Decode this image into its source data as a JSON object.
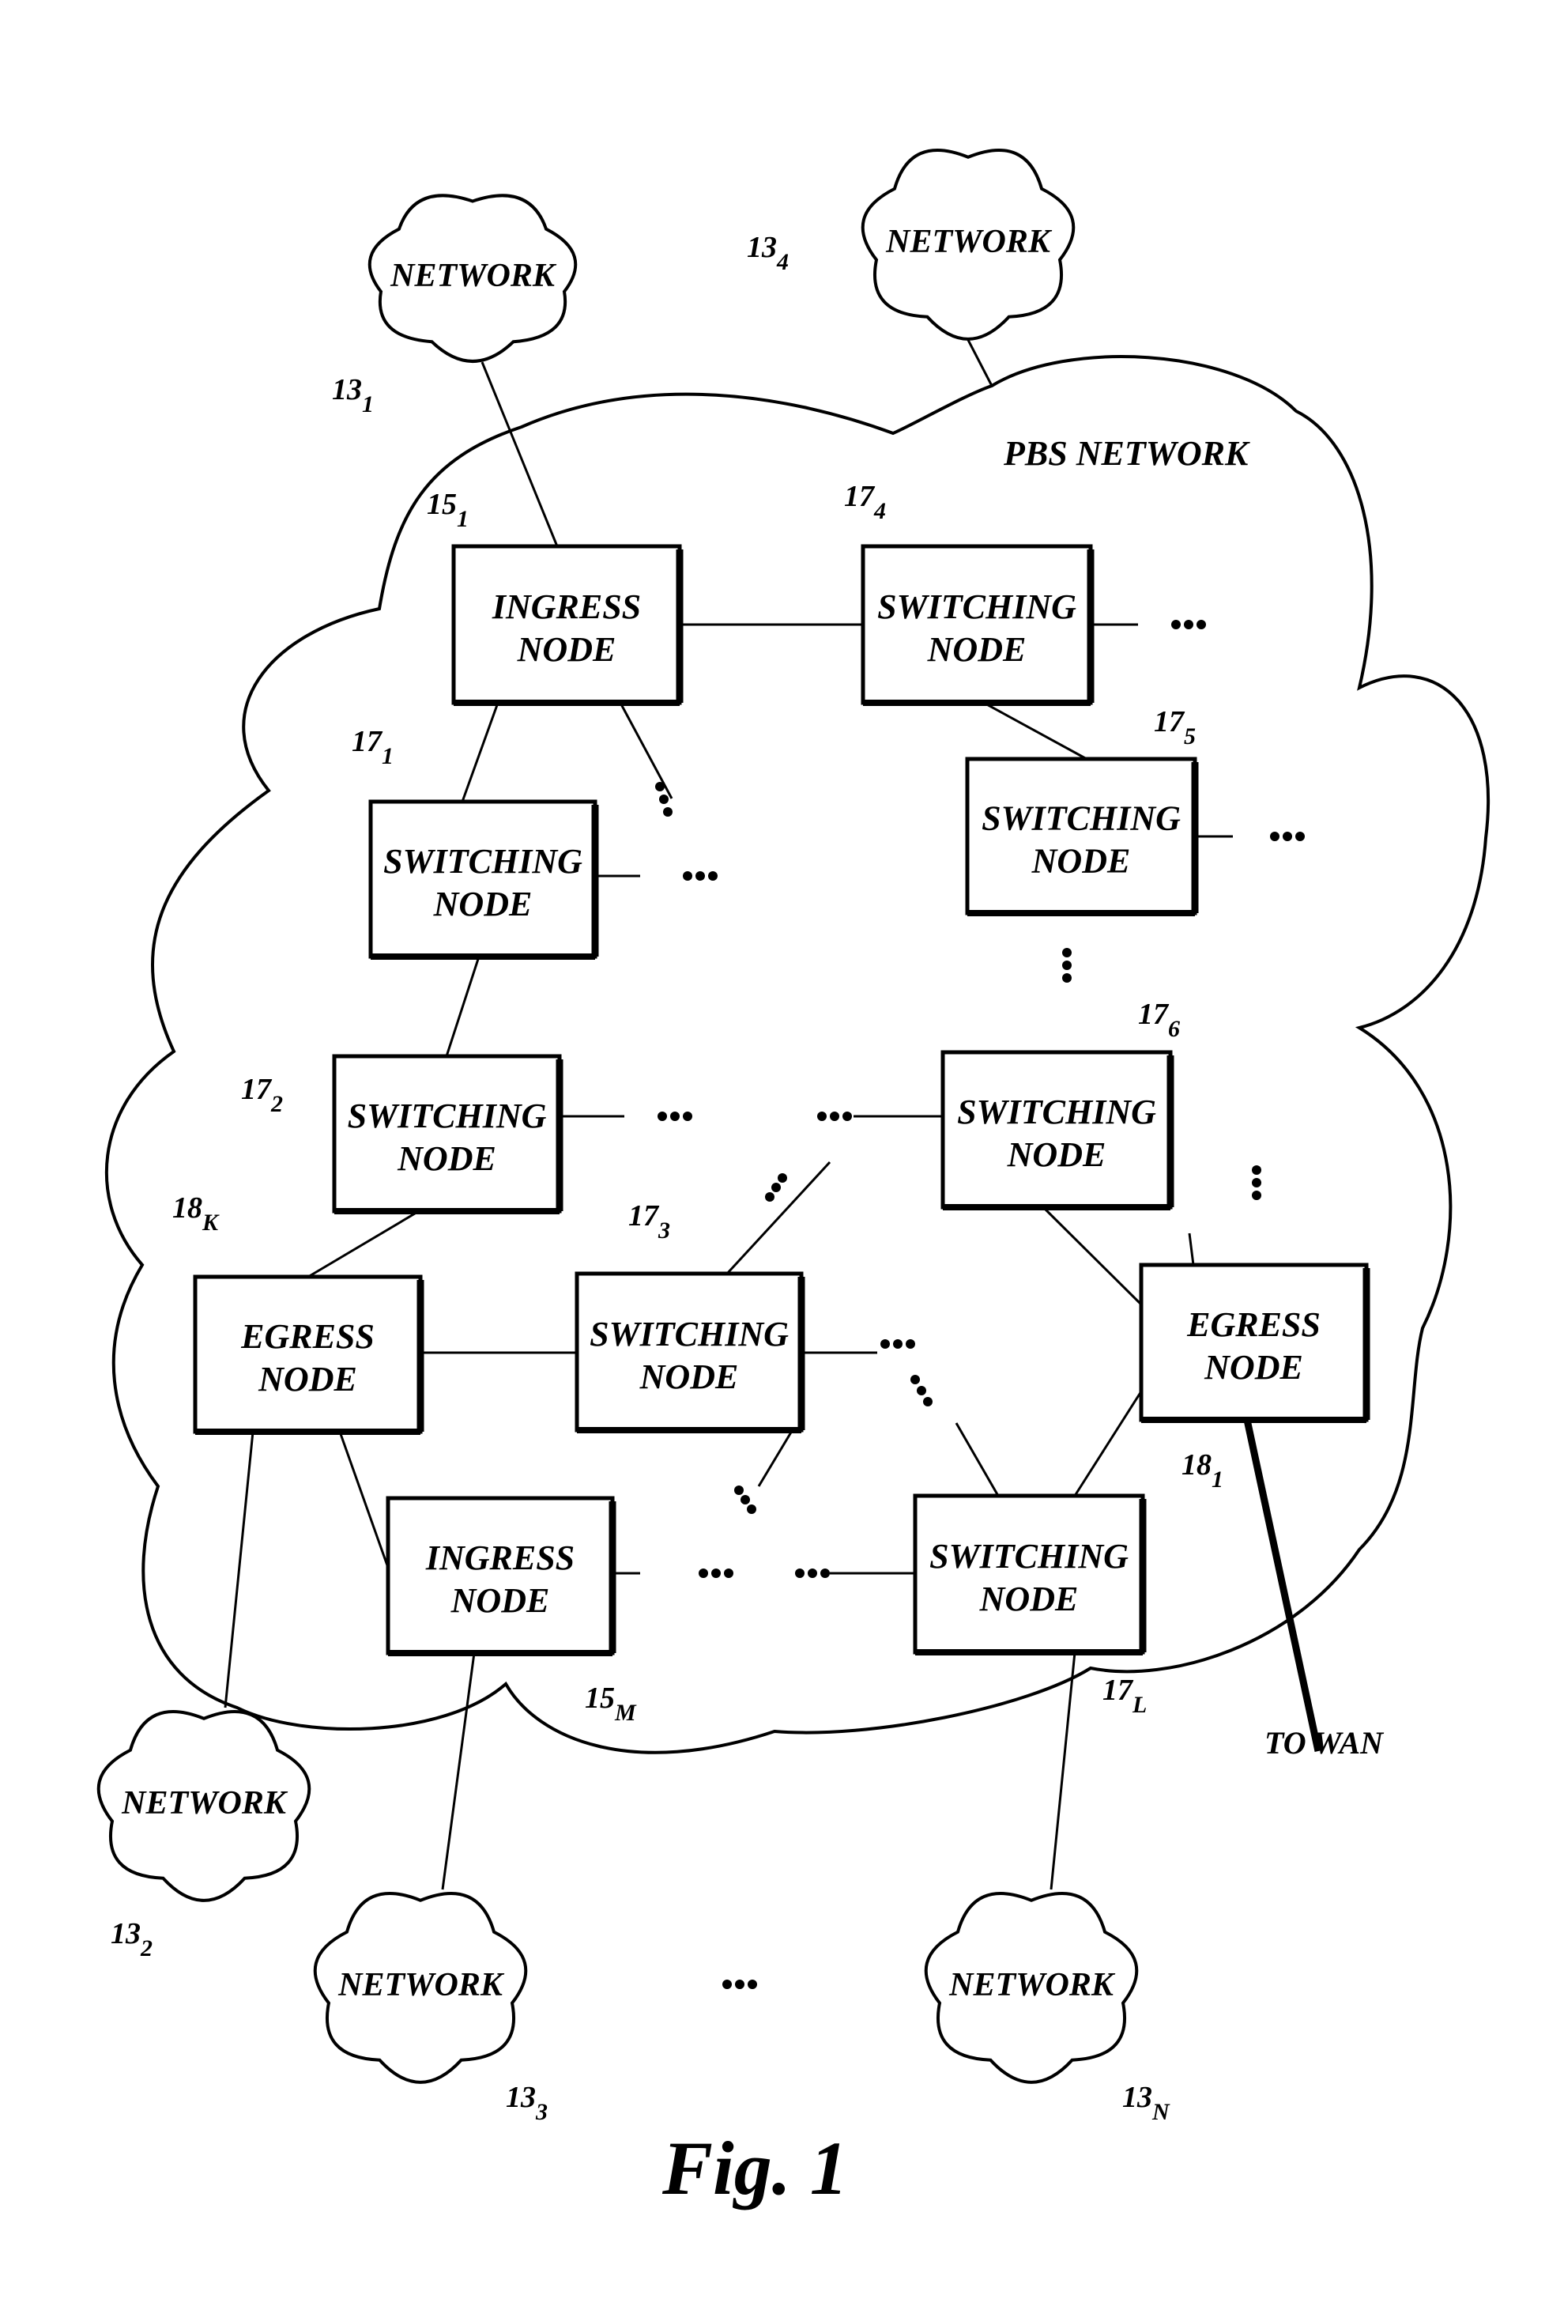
{
  "figure": {
    "caption": "Fig. 1",
    "region_label": "PBS NETWORK",
    "to_wan_label": "TO WAN"
  },
  "nodes": [
    {
      "id": "ingress-15-1",
      "line1": "INGRESS",
      "line2": "NODE",
      "ref": "15",
      "sub": "1"
    },
    {
      "id": "switching-17-4",
      "line1": "SWITCHING",
      "line2": "NODE",
      "ref": "17",
      "sub": "4"
    },
    {
      "id": "switching-17-5",
      "line1": "SWITCHING",
      "line2": "NODE",
      "ref": "17",
      "sub": "5"
    },
    {
      "id": "switching-17-1",
      "line1": "SWITCHING",
      "line2": "NODE",
      "ref": "17",
      "sub": "1"
    },
    {
      "id": "switching-17-2",
      "line1": "SWITCHING",
      "line2": "NODE",
      "ref": "17",
      "sub": "2"
    },
    {
      "id": "switching-17-6",
      "line1": "SWITCHING",
      "line2": "NODE",
      "ref": "17",
      "sub": "6"
    },
    {
      "id": "egress-18-k",
      "line1": "EGRESS",
      "line2": "NODE",
      "ref": "18",
      "sub": "K"
    },
    {
      "id": "switching-17-3",
      "line1": "SWITCHING",
      "line2": "NODE",
      "ref": "17",
      "sub": "3"
    },
    {
      "id": "egress-18-1",
      "line1": "EGRESS",
      "line2": "NODE",
      "ref": "18",
      "sub": "1"
    },
    {
      "id": "ingress-15-m",
      "line1": "INGRESS",
      "line2": "NODE",
      "ref": "15",
      "sub": "M"
    },
    {
      "id": "switching-17-l",
      "line1": "SWITCHING",
      "line2": "NODE",
      "ref": "17",
      "sub": "L"
    }
  ],
  "networks": [
    {
      "id": "network-13-1",
      "label": "NETWORK",
      "ref": "13",
      "sub": "1"
    },
    {
      "id": "network-13-4",
      "label": "NETWORK",
      "ref": "13",
      "sub": "4"
    },
    {
      "id": "network-13-2",
      "label": "NETWORK",
      "ref": "13",
      "sub": "2"
    },
    {
      "id": "network-13-3",
      "label": "NETWORK",
      "ref": "13",
      "sub": "3"
    },
    {
      "id": "network-13-n",
      "label": "NETWORK",
      "ref": "13",
      "sub": "N"
    }
  ],
  "ellipsis": "•••"
}
